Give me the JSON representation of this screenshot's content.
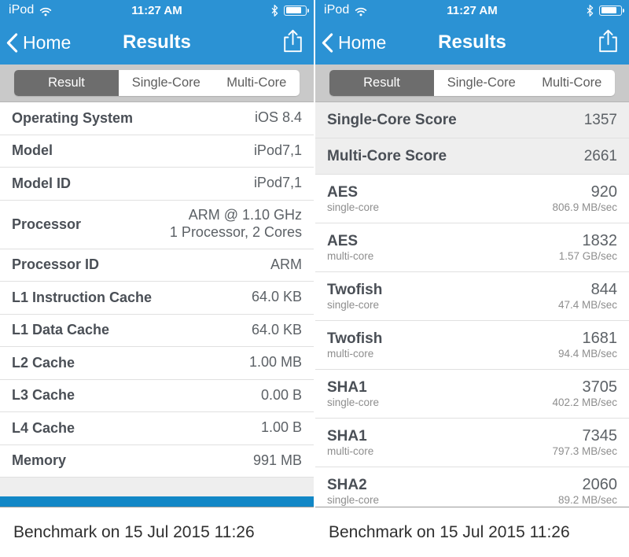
{
  "colors": {
    "header_blue": "#2b92d4",
    "bar_blue": "#1287c6",
    "segment_selected": "#6d6d6d",
    "segment_bg": "#c9c9c9",
    "row_alt": "#eeeeee"
  },
  "panels": [
    {
      "id": "left",
      "status_bar": {
        "carrier": "iPod",
        "wifi_icon": "wifi-icon",
        "time": "11:27 AM",
        "bluetooth_icon": "bluetooth-icon",
        "battery_icon": "battery-icon"
      },
      "nav": {
        "back_label": "Home",
        "back_icon": "chevron-left-icon",
        "title": "Results",
        "share_icon": "share-icon"
      },
      "segments": [
        {
          "label": "Result",
          "selected": true
        },
        {
          "label": "Single-Core",
          "selected": false
        },
        {
          "label": "Multi-Core",
          "selected": false
        }
      ],
      "rows": [
        {
          "key": "Operating System",
          "value": "iOS 8.4"
        },
        {
          "key": "Model",
          "value": "iPod7,1"
        },
        {
          "key": "Model ID",
          "value": "iPod7,1"
        },
        {
          "key": "Processor",
          "value": "ARM @ 1.10 GHz\n1 Processor, 2 Cores",
          "tall": true
        },
        {
          "key": "Processor ID",
          "value": "ARM"
        },
        {
          "key": "L1 Instruction Cache",
          "value": "64.0 KB"
        },
        {
          "key": "L1 Data Cache",
          "value": "64.0 KB"
        },
        {
          "key": "L2 Cache",
          "value": "1.00 MB"
        },
        {
          "key": "L3 Cache",
          "value": "0.00 B"
        },
        {
          "key": "L4 Cache",
          "value": "1.00 B"
        },
        {
          "key": "Memory",
          "value": "991 MB"
        }
      ],
      "caption": "Benchmark on 15 Jul 2015 11:26"
    },
    {
      "id": "right",
      "status_bar": {
        "carrier": "iPod",
        "wifi_icon": "wifi-icon",
        "time": "11:27 AM",
        "bluetooth_icon": "bluetooth-icon",
        "battery_icon": "battery-icon"
      },
      "nav": {
        "back_label": "Home",
        "back_icon": "chevron-left-icon",
        "title": "Results",
        "share_icon": "share-icon"
      },
      "segments": [
        {
          "label": "Result",
          "selected": true
        },
        {
          "label": "Single-Core",
          "selected": false
        },
        {
          "label": "Multi-Core",
          "selected": false
        }
      ],
      "scores": [
        {
          "key": "Single-Core Score",
          "value": "1357"
        },
        {
          "key": "Multi-Core Score",
          "value": "2661"
        }
      ],
      "benchmarks": [
        {
          "name": "AES",
          "mode": "single-core",
          "score": "920",
          "rate": "806.9 MB/sec"
        },
        {
          "name": "AES",
          "mode": "multi-core",
          "score": "1832",
          "rate": "1.57 GB/sec"
        },
        {
          "name": "Twofish",
          "mode": "single-core",
          "score": "844",
          "rate": "47.4 MB/sec"
        },
        {
          "name": "Twofish",
          "mode": "multi-core",
          "score": "1681",
          "rate": "94.4 MB/sec"
        },
        {
          "name": "SHA1",
          "mode": "single-core",
          "score": "3705",
          "rate": "402.2 MB/sec"
        },
        {
          "name": "SHA1",
          "mode": "multi-core",
          "score": "7345",
          "rate": "797.3 MB/sec"
        },
        {
          "name": "SHA2",
          "mode": "single-core",
          "score": "2060",
          "rate": "89.2 MB/sec"
        }
      ],
      "caption": "Benchmark on 15 Jul 2015 11:26"
    }
  ]
}
